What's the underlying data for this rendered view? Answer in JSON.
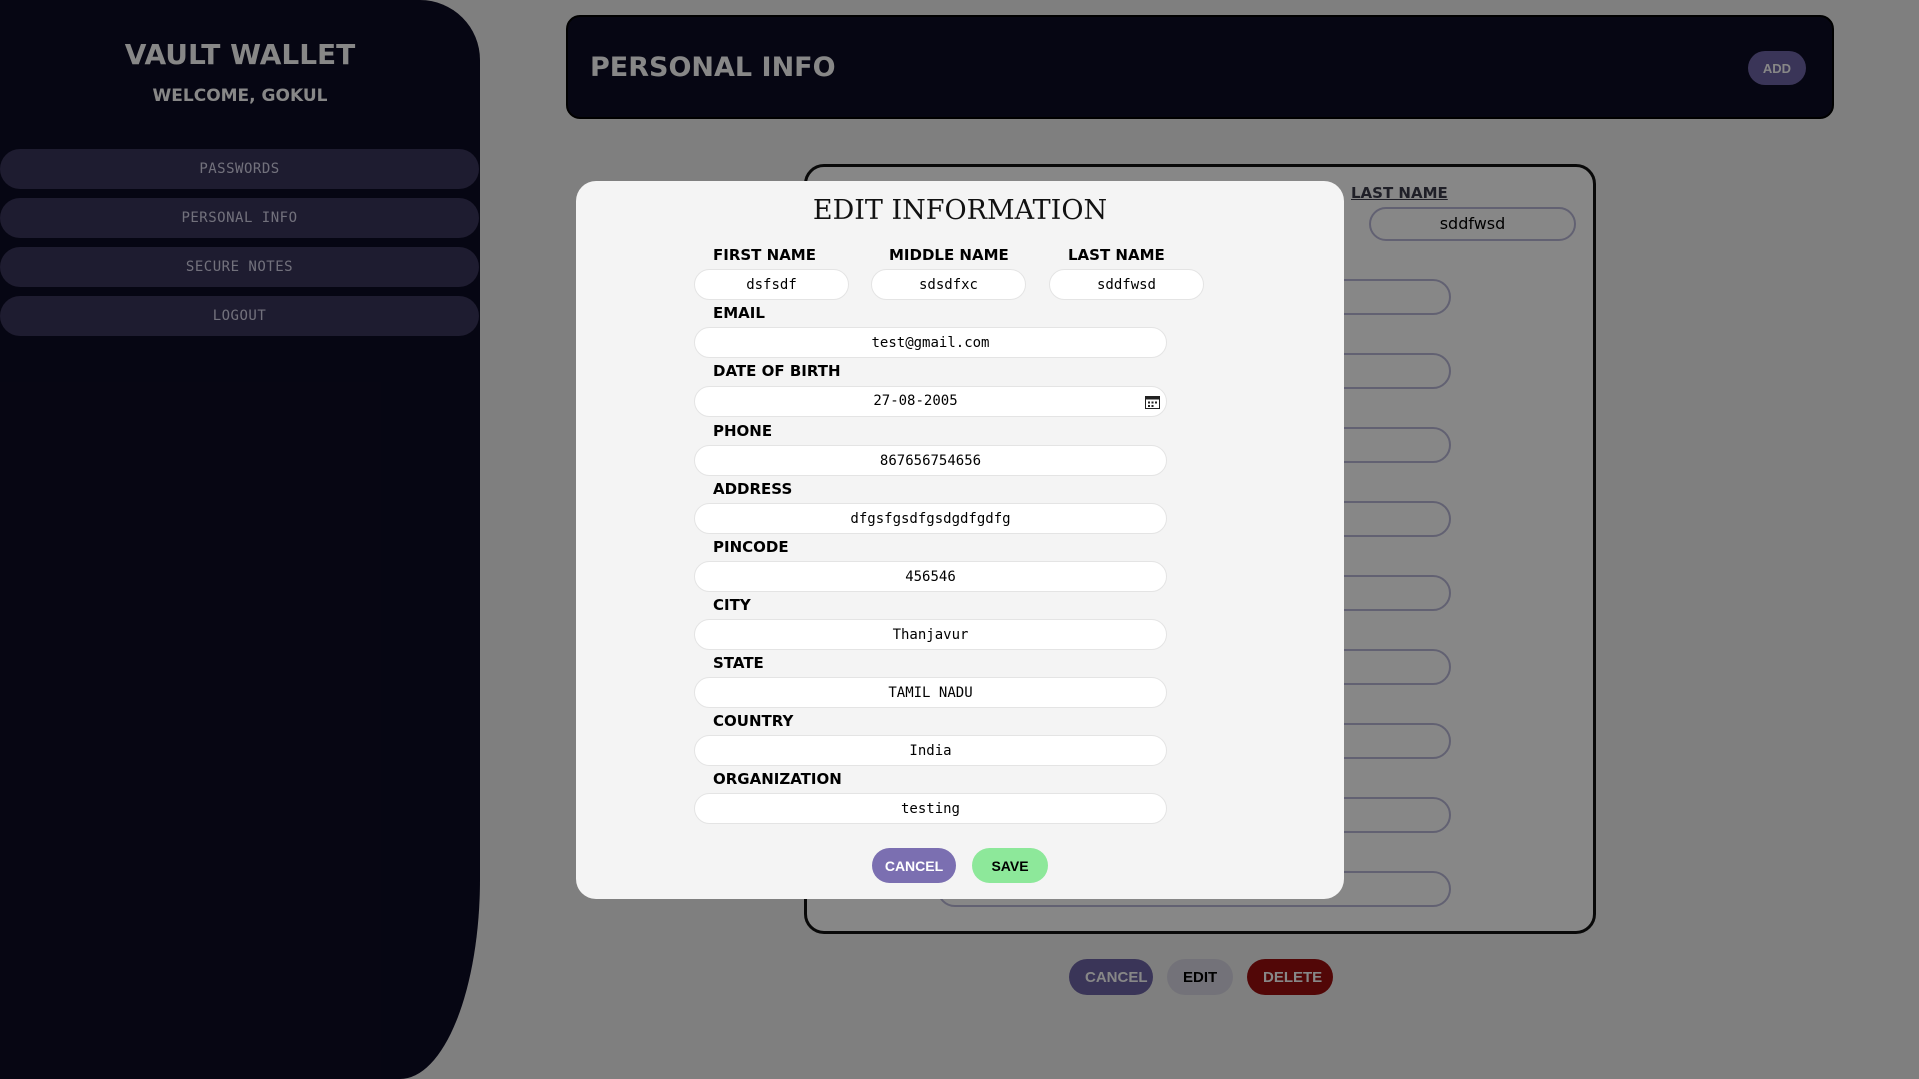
{
  "sidebar": {
    "brand": "VAULT WALLET",
    "welcome": "WELCOME, GOKUL",
    "items": [
      {
        "label": "PASSWORDS"
      },
      {
        "label": "PERSONAL INFO"
      },
      {
        "label": "SECURE NOTES"
      },
      {
        "label": "LOGOUT"
      }
    ]
  },
  "header": {
    "title": "PERSONAL INFO",
    "add_label": "ADD"
  },
  "card": {
    "last_name_label": "LAST NAME",
    "last_name_value": "sddfwsd",
    "buttons": {
      "cancel": "CANCEL",
      "edit": "EDIT",
      "delete": "DELETE"
    }
  },
  "modal": {
    "title": "EDIT INFORMATION",
    "first_name": {
      "label": "FIRST NAME",
      "value": "dsfsdf"
    },
    "middle_name": {
      "label": "MIDDLE NAME",
      "value": "sdsdfxc"
    },
    "last_name": {
      "label": "LAST NAME",
      "value": "sddfwsd"
    },
    "email": {
      "label": "EMAIL",
      "value": "test@gmail.com"
    },
    "dob": {
      "label": "DATE OF BIRTH",
      "value": "27-08-2005"
    },
    "phone": {
      "label": "PHONE",
      "value": "867656754656"
    },
    "address": {
      "label": "ADDRESS",
      "value": "dfgsfgsdfgsdgdfgdfg"
    },
    "pincode": {
      "label": "PINCODE",
      "value": "456546"
    },
    "city": {
      "label": "CITY",
      "value": "Thanjavur"
    },
    "state": {
      "label": "STATE",
      "value": "TAMIL NADU"
    },
    "country": {
      "label": "COUNTRY",
      "value": "India"
    },
    "organization": {
      "label": "ORGANIZATION",
      "value": "testing"
    },
    "cancel_label": "CANCEL",
    "save_label": "SAVE"
  }
}
